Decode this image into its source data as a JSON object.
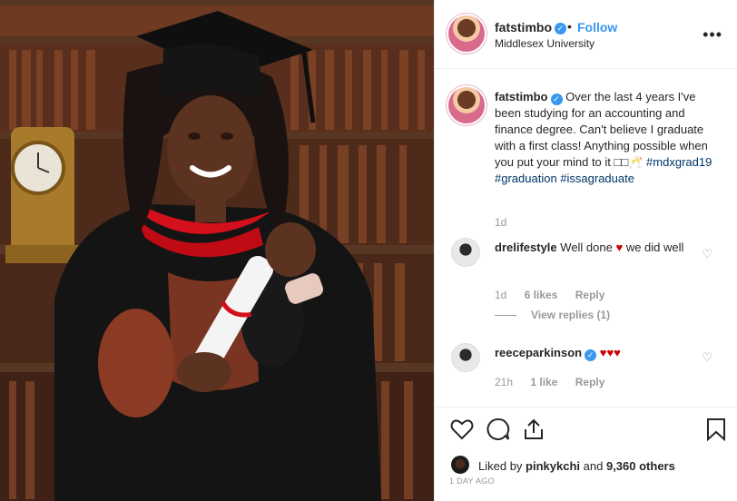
{
  "post": {
    "author": {
      "username": "fatstimbo",
      "verified_mark": "✓",
      "follow_label": "Follow",
      "location": "Middlesex University"
    },
    "more_icon": "•••",
    "caption": {
      "username": "fatstimbo",
      "text": "Over the last 4 years I've been studying for an accounting and finance degree. Can't believe I graduate with a first class! Anything possible when you put your mind to it",
      "emoji": "□□🥂",
      "hashtags": [
        "#mdxgrad19",
        "#graduation",
        "#issagraduate"
      ],
      "time": "1d"
    },
    "comments": [
      {
        "username": "drelifestyle",
        "text_before": "Well done",
        "heart": "♥",
        "text_after": "we did well",
        "time": "1d",
        "likes": "6 likes",
        "reply_label": "Reply",
        "view_replies": "View replies (1)"
      },
      {
        "username": "reeceparkinson",
        "verified_mark": "✓",
        "hearts": "♥♥♥",
        "time": "21h",
        "likes": "1 like",
        "reply_label": "Reply"
      }
    ],
    "liked_by": {
      "prefix": "Liked by",
      "user": "pinkykchi",
      "conjunction": "and",
      "others": "9,360 others"
    },
    "timestamp": "1 DAY AGO"
  },
  "icons": [
    "heart-icon",
    "comment-icon",
    "share-icon",
    "bookmark-icon",
    "ellipsis-icon",
    "verified-badge-icon"
  ],
  "colors": {
    "link_blue": "#3897f0",
    "hashtag": "#003569",
    "heart_red": "#cc0000"
  }
}
